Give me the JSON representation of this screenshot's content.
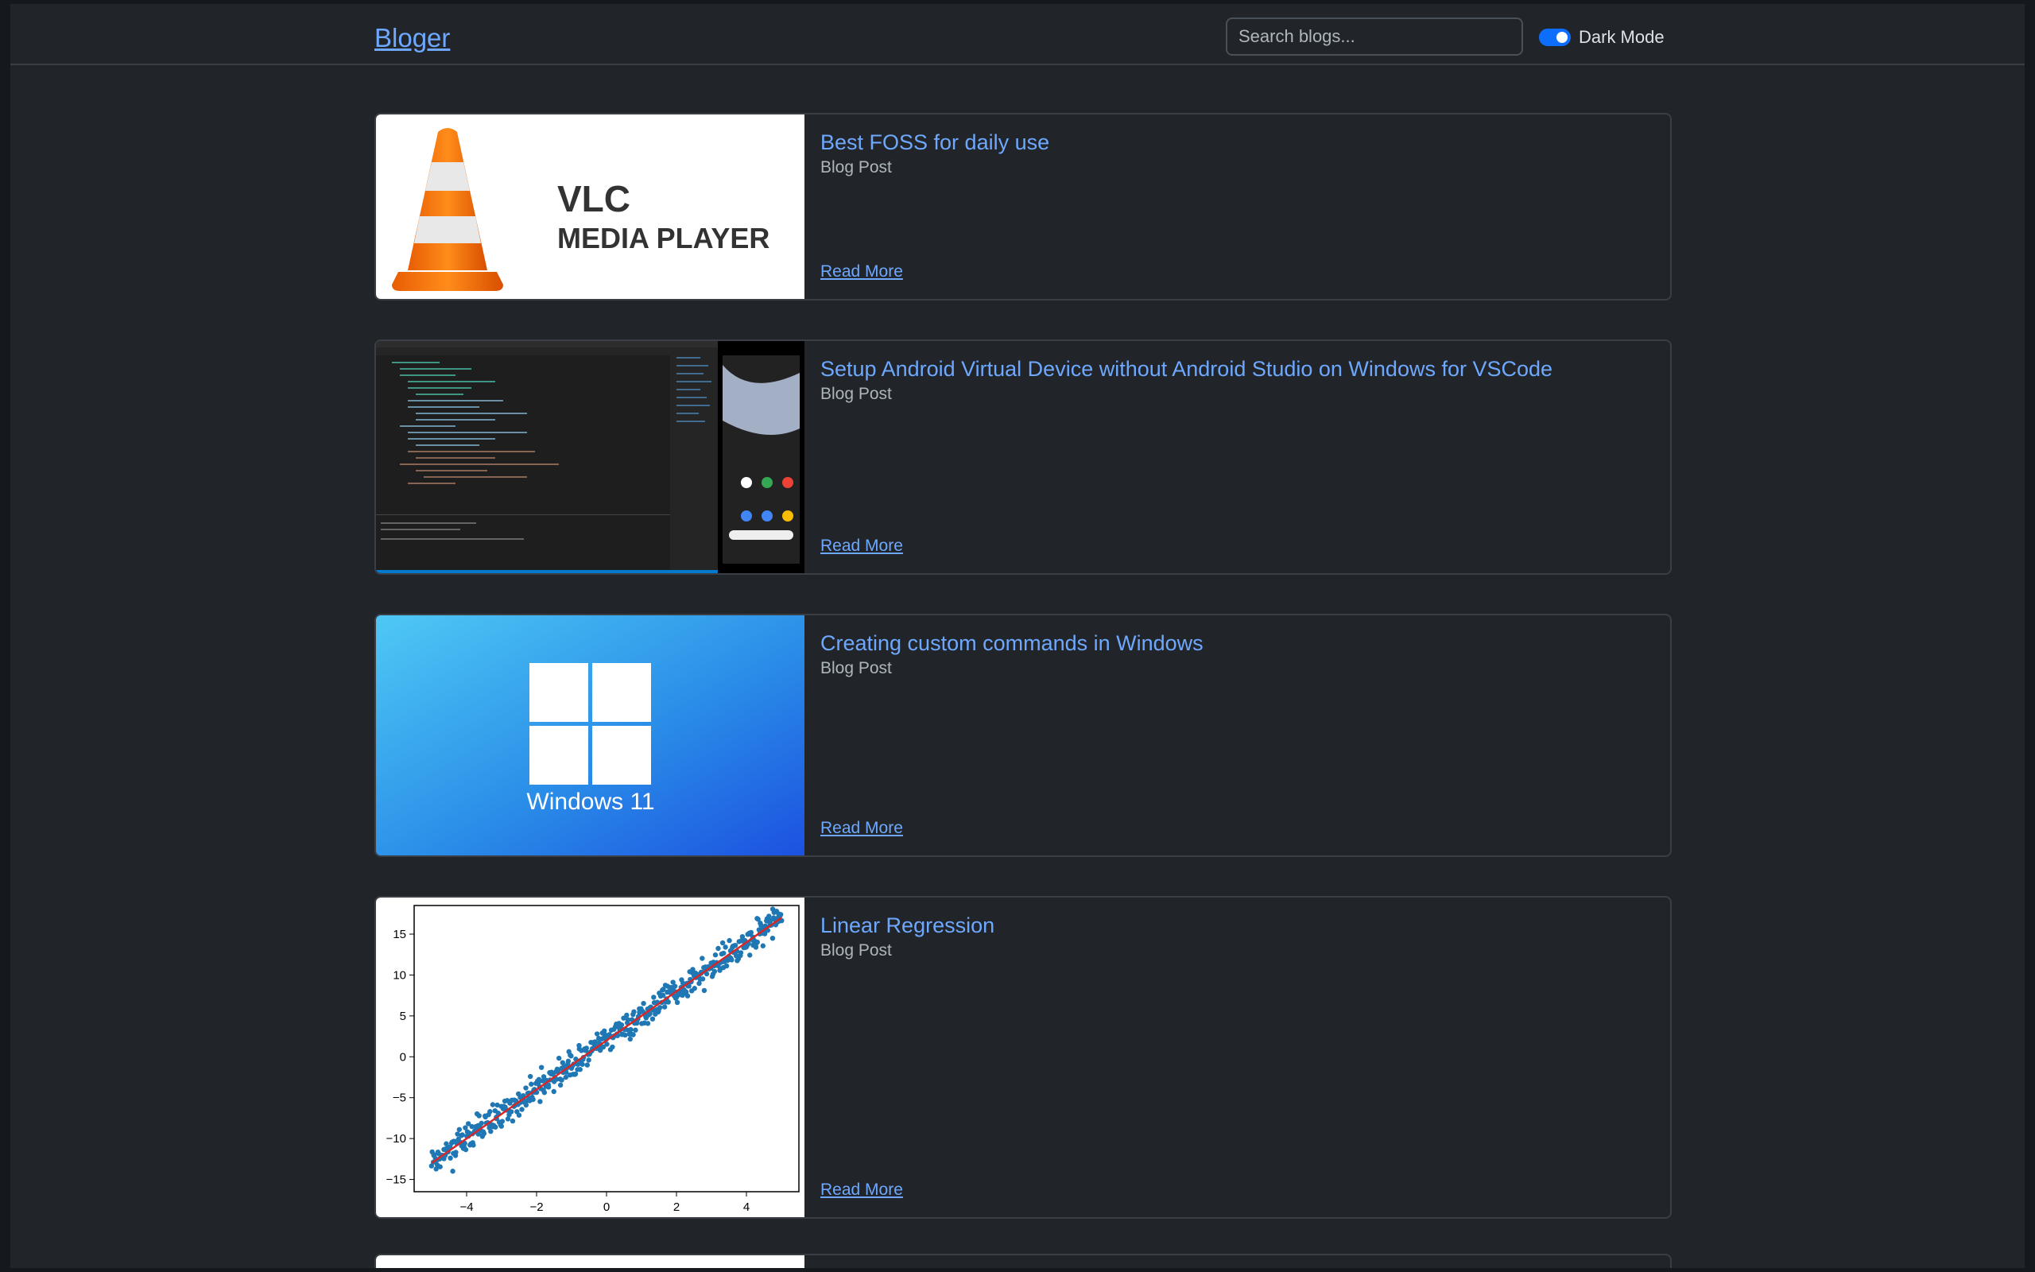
{
  "header": {
    "brand": "Bloger",
    "search_placeholder": "Search blogs...",
    "dark_mode_label": "Dark Mode",
    "dark_mode_on": true
  },
  "posts": [
    {
      "title": "Best FOSS for daily use",
      "subtitle": "Blog Post",
      "read_more": "Read More",
      "thumb": {
        "line1": "VLC",
        "line2": "MEDIA PLAYER"
      }
    },
    {
      "title": "Setup Android Virtual Device without Android Studio on Windows for VSCode",
      "subtitle": "Blog Post",
      "read_more": "Read More"
    },
    {
      "title": "Creating custom commands in Windows",
      "subtitle": "Blog Post",
      "read_more": "Read More",
      "thumb": {
        "text": "Windows 11"
      }
    },
    {
      "title": "Linear Regression",
      "subtitle": "Blog Post",
      "read_more": "Read More"
    }
  ],
  "colors": {
    "background": "#212529",
    "link": "#6ea8fe",
    "switch": "#0d6efd"
  },
  "chart_data": {
    "type": "scatter",
    "xlim": [
      -5.5,
      5.5
    ],
    "ylim": [
      -16.5,
      18.5
    ],
    "xticks": [
      -4,
      -2,
      0,
      2,
      4
    ],
    "yticks": [
      -15,
      -10,
      -5,
      0,
      5,
      10,
      15
    ],
    "x_tick_labels": [
      "−4",
      "−2",
      "0",
      "2",
      "4"
    ],
    "y_tick_labels": [
      "−15",
      "−10",
      "−5",
      "0",
      "5",
      "10",
      "15"
    ],
    "series": [
      {
        "kind": "scatter",
        "color": "#1f77b4",
        "slope": 3,
        "intercept": 2,
        "x_range": [
          -5,
          5
        ],
        "count": 500
      },
      {
        "kind": "line",
        "color": "#d62728",
        "x": [
          -5,
          5
        ],
        "y": [
          -13,
          17
        ]
      }
    ]
  }
}
